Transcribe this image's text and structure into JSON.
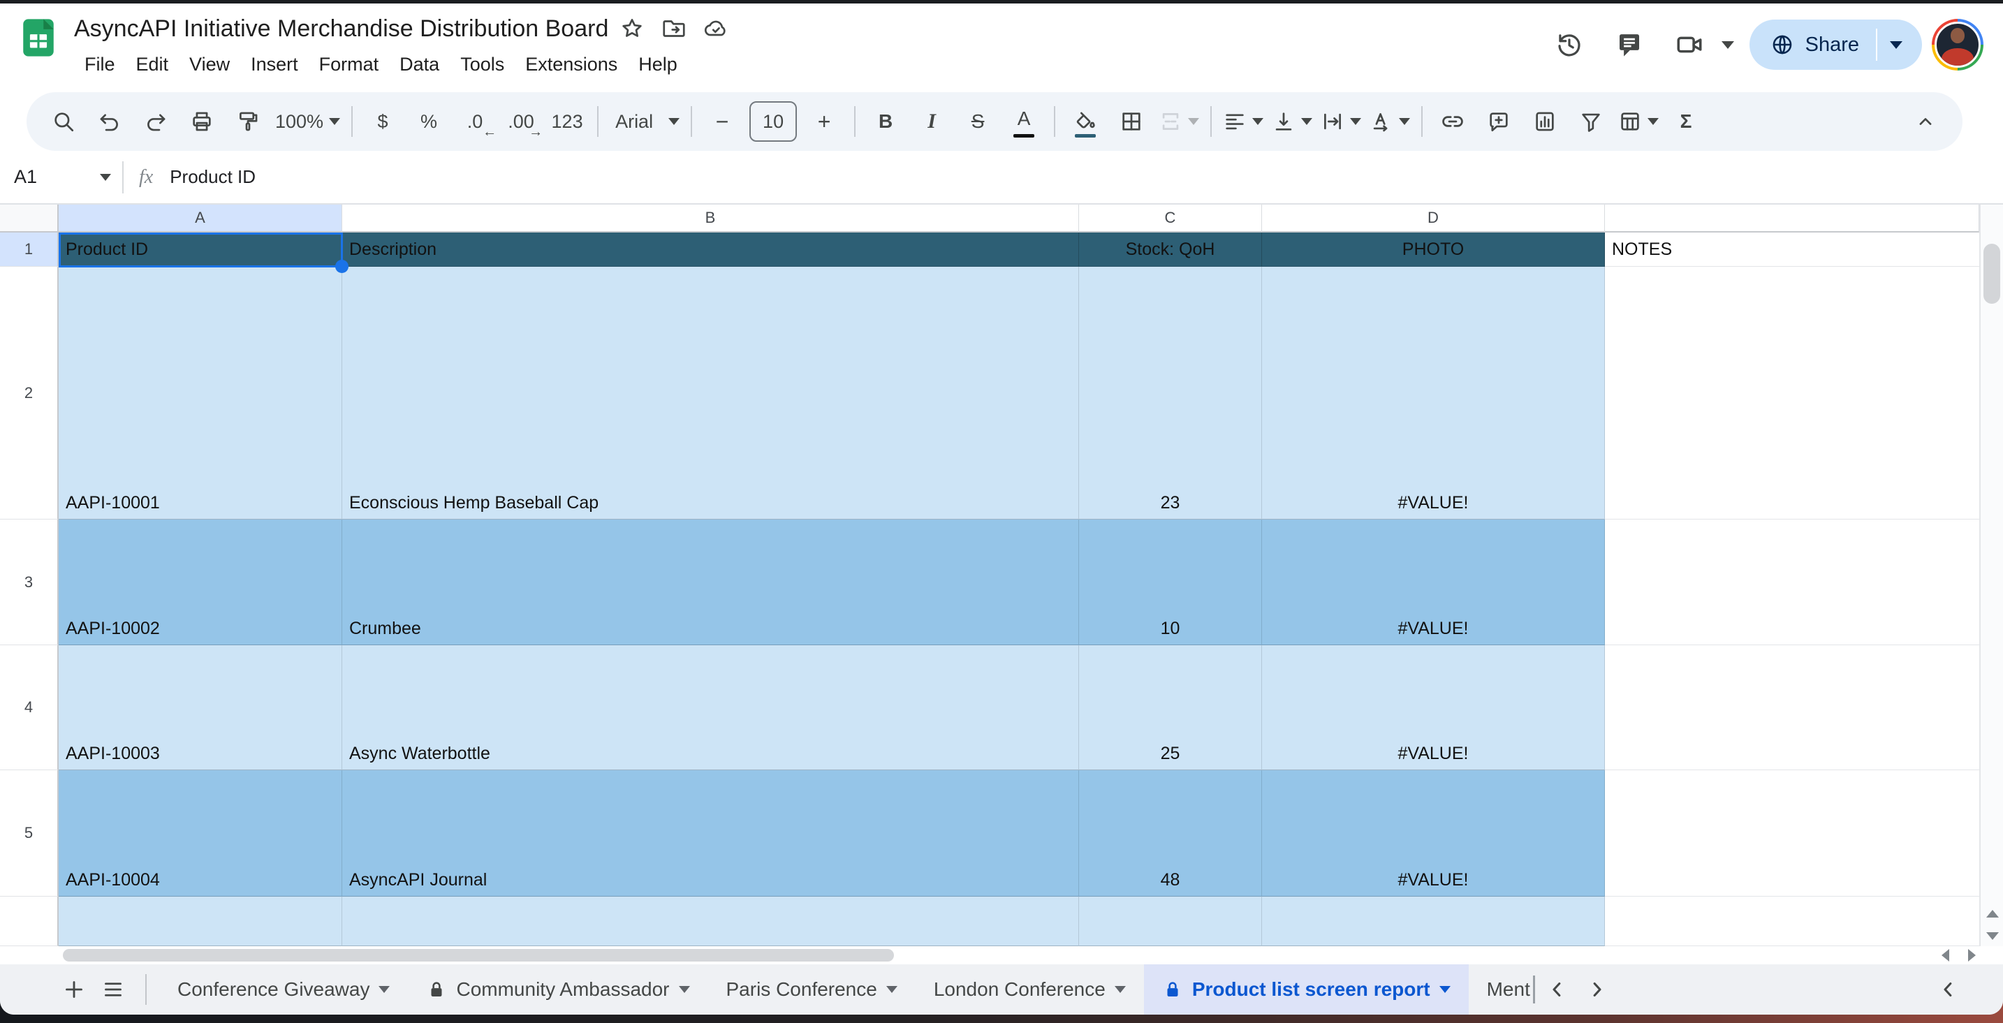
{
  "window": {
    "title": "AsyncAPI Initiative Merchandise Distribution Board"
  },
  "menubar": {
    "items": [
      "File",
      "Edit",
      "View",
      "Insert",
      "Format",
      "Data",
      "Tools",
      "Extensions",
      "Help"
    ]
  },
  "topbar_actions": {
    "share_label": "Share"
  },
  "toolbar": {
    "zoom_value": "100%",
    "currency_label": "$",
    "percent_label": "%",
    "decrease_decimal_label": ".0",
    "increase_decimal_label": ".00",
    "more_formats_label": "123",
    "font_name": "Arial",
    "font_size": "10",
    "bold_label": "B",
    "italic_label": "I",
    "strikethrough_label": "S",
    "text_color_label": "A",
    "functions_label": "Σ"
  },
  "formula_bar": {
    "cell_reference": "A1",
    "fx_label": "fx",
    "content": "Product ID"
  },
  "grid": {
    "column_headers": [
      "A",
      "B",
      "C",
      "D",
      ""
    ],
    "selected_cell": "A1",
    "rows": [
      {
        "num": "1",
        "type": "header",
        "cells": {
          "a": "Product ID",
          "b": "Description",
          "c": "Stock: QoH",
          "d": "PHOTO",
          "e": "NOTES"
        }
      },
      {
        "num": "2",
        "tone": "light",
        "cells": {
          "a": "AAPI-10001",
          "b": "Econscious Hemp Baseball Cap",
          "c": "23",
          "d": "#VALUE!",
          "e": ""
        }
      },
      {
        "num": "3",
        "tone": "dark",
        "cells": {
          "a": "AAPI-10002",
          "b": "Crumbee",
          "c": "10",
          "d": "#VALUE!",
          "e": ""
        }
      },
      {
        "num": "4",
        "tone": "light",
        "cells": {
          "a": "AAPI-10003",
          "b": "Async Waterbottle",
          "c": "25",
          "d": "#VALUE!",
          "e": ""
        }
      },
      {
        "num": "5",
        "tone": "dark",
        "cells": {
          "a": "AAPI-10004",
          "b": "AsyncAPI Journal",
          "c": "48",
          "d": "#VALUE!",
          "e": ""
        }
      },
      {
        "num": "",
        "tone": "light",
        "cells": {
          "a": "",
          "b": "",
          "c": "",
          "d": "",
          "e": ""
        }
      }
    ]
  },
  "sheet_tabs": {
    "tabs": [
      {
        "label": "Conference Giveaway",
        "locked": false,
        "active": false,
        "truncated": false
      },
      {
        "label": "Community Ambassador",
        "locked": true,
        "active": false,
        "truncated": false
      },
      {
        "label": "Paris Conference",
        "locked": false,
        "active": false,
        "truncated": false
      },
      {
        "label": "London Conference",
        "locked": false,
        "active": false,
        "truncated": false
      },
      {
        "label": "Product list screen report",
        "locked": true,
        "active": true,
        "truncated": false
      },
      {
        "label": "Ment",
        "locked": false,
        "active": false,
        "truncated": true
      }
    ]
  },
  "colors": {
    "header_row_fill": "#2d5f75",
    "row_light": "#cde4f6",
    "row_dark": "#95c5e8",
    "selection_blue": "#1a73e8",
    "active_tab_bg": "#dde3f8",
    "active_tab_text": "#0b57d0",
    "share_button_bg": "#c9e2fa",
    "logo_green": "#23a566"
  }
}
